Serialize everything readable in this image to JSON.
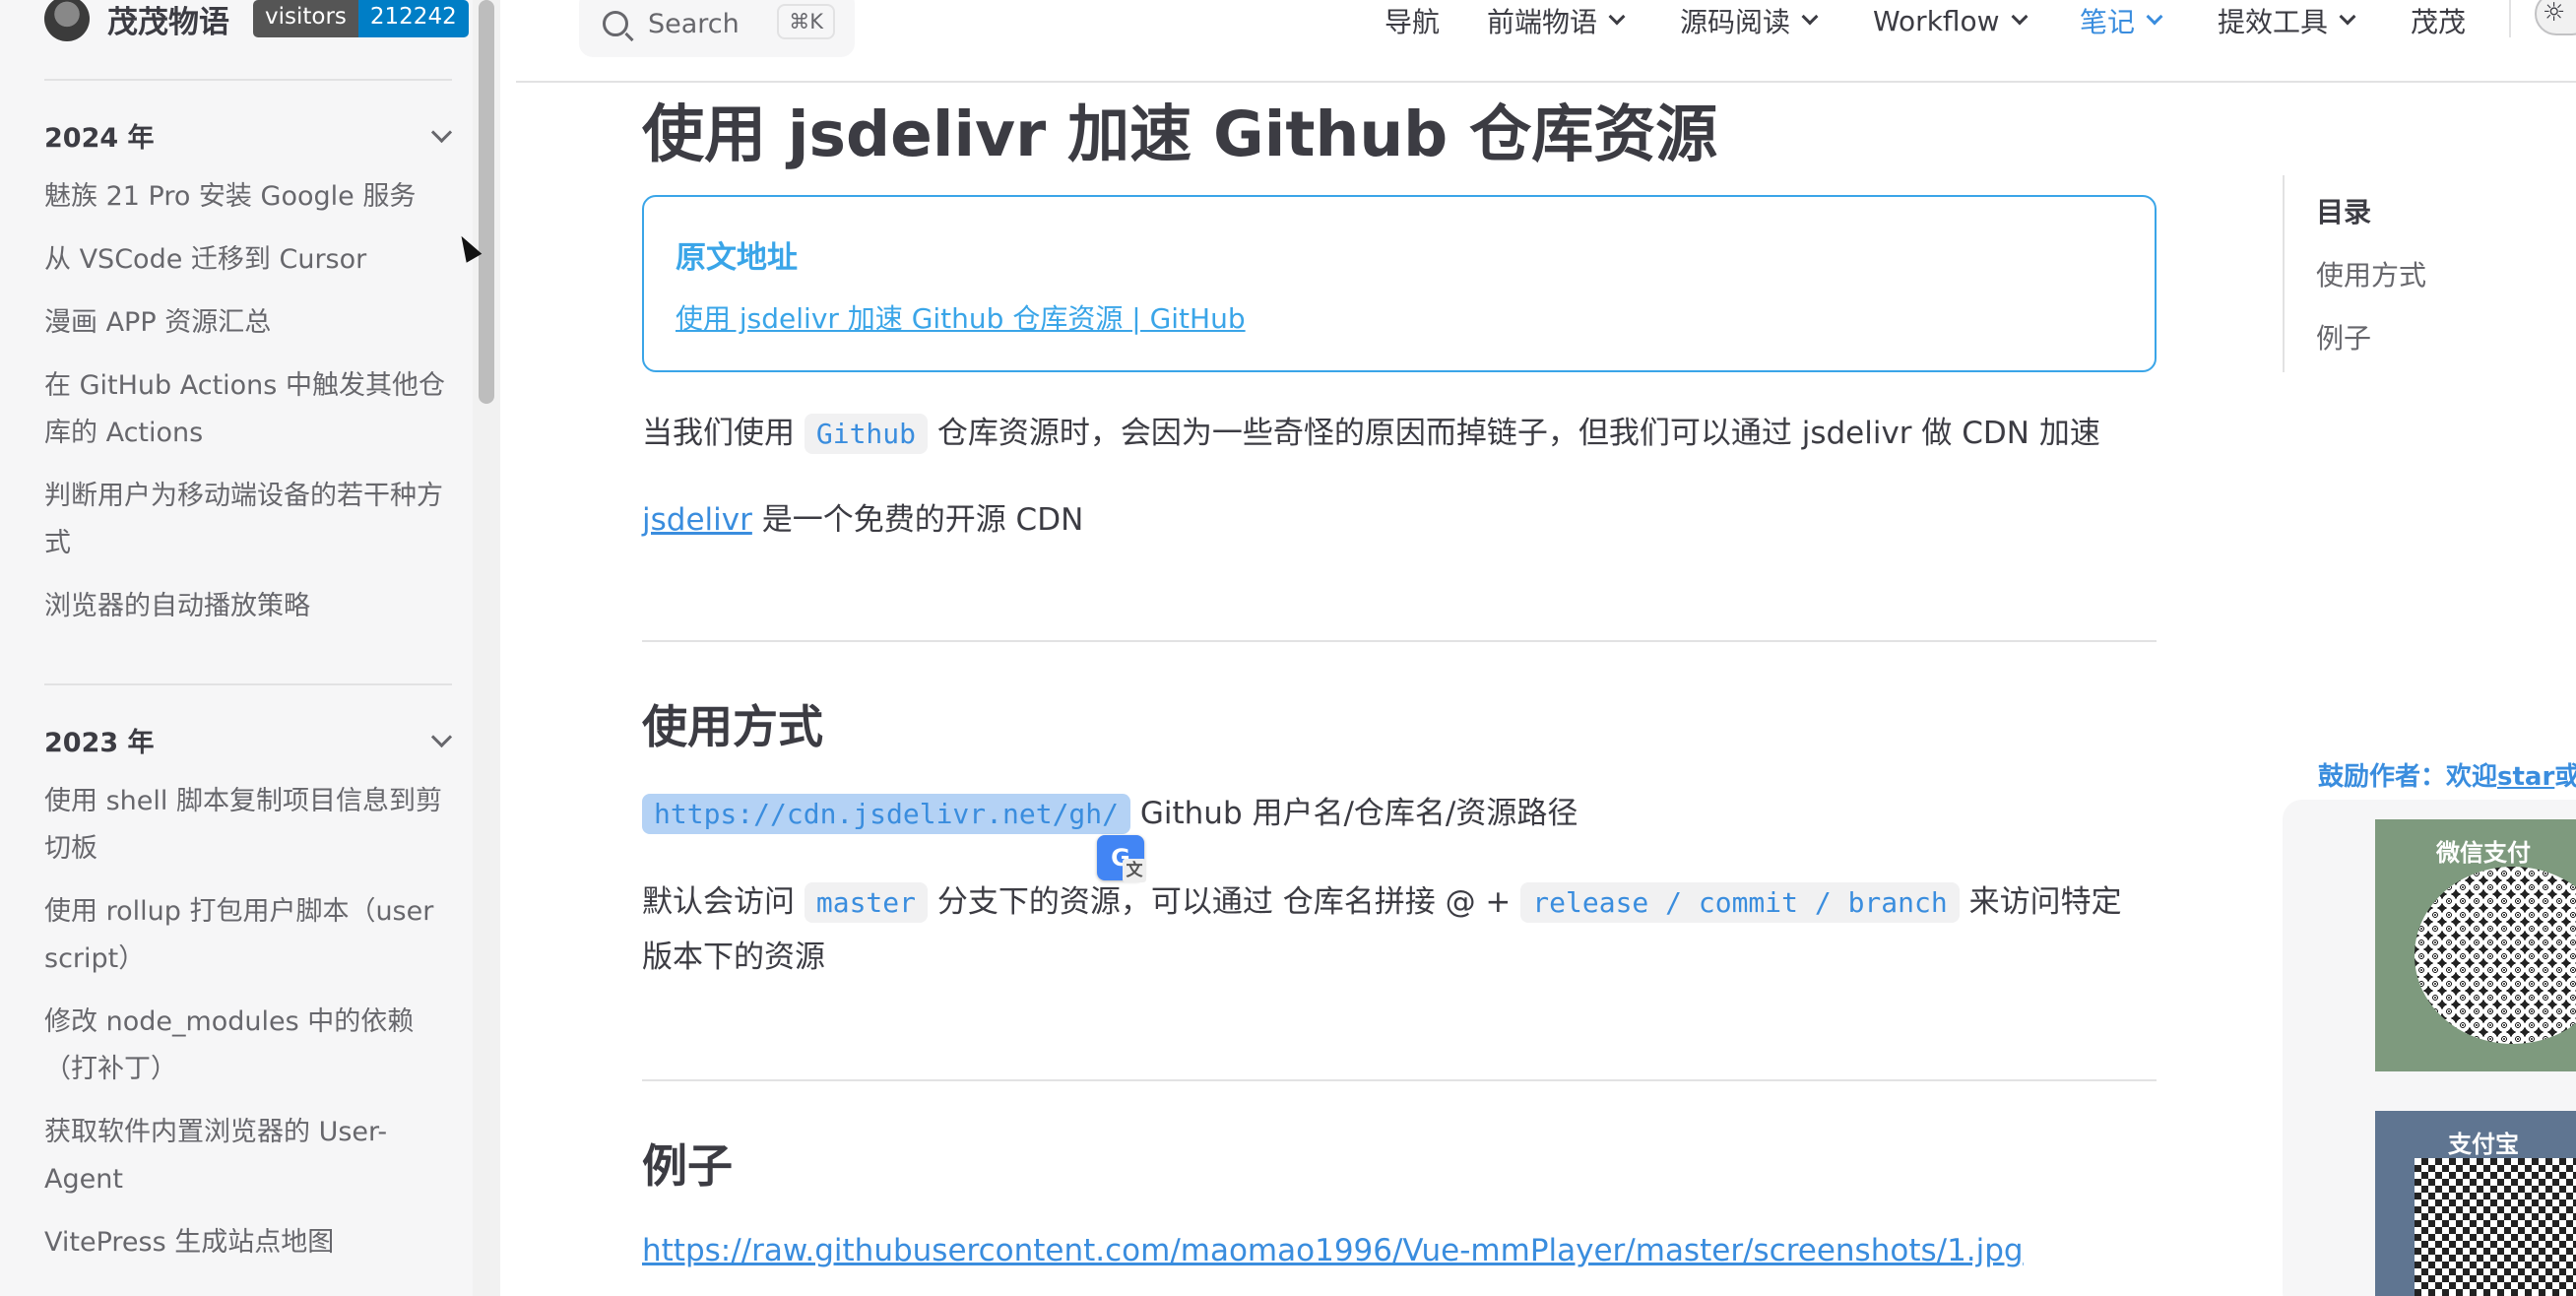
{
  "brand": {
    "name": "茂茂物语",
    "badge_label": "visitors",
    "badge_count": "212242"
  },
  "sidebar": {
    "groups": [
      {
        "title": "2024 年",
        "items": [
          "魅族 21 Pro 安装 Google 服务",
          "从 VSCode 迁移到 Cursor",
          "漫画 APP 资源汇总",
          "在 GitHub Actions 中触发其他仓库的 Actions",
          "判断用户为移动端设备的若干种方式",
          "浏览器的自动播放策略"
        ]
      },
      {
        "title": "2023 年",
        "items": [
          "使用 shell 脚本复制项目信息到剪切板",
          "使用 rollup 打包用户脚本（user script）",
          "修改 node_modules 中的依赖（打补丁）",
          "获取软件内置浏览器的 User-Agent",
          "VitePress 生成站点地图"
        ]
      }
    ]
  },
  "header": {
    "search_label": "Search",
    "search_shortcut": "⌘K",
    "nav": [
      {
        "label": "导航",
        "dropdown": false,
        "active": false
      },
      {
        "label": "前端物语",
        "dropdown": true,
        "active": false
      },
      {
        "label": "源码阅读",
        "dropdown": true,
        "active": false
      },
      {
        "label": "Workflow",
        "dropdown": true,
        "active": false
      },
      {
        "label": "笔记",
        "dropdown": true,
        "active": true
      },
      {
        "label": "提效工具",
        "dropdown": true,
        "active": false
      },
      {
        "label": "茂茂",
        "dropdown": false,
        "active": false
      }
    ]
  },
  "article": {
    "title": "使用 jsdelivr 加速 Github 仓库资源",
    "callout": {
      "title": "原文地址",
      "link": "使用 jsdelivr 加速 Github 仓库资源 | GitHub"
    },
    "p1": {
      "before": "当我们使用",
      "code": "Github",
      "after": "仓库资源时，会因为一些奇怪的原因而掉链子，但我们可以通过 jsdelivr 做 CDN 加速"
    },
    "p2": {
      "link": "jsdelivr",
      "after": "是一个免费的开源 CDN"
    },
    "h2_usage": "使用方式",
    "p3": {
      "code": "https://cdn.jsdelivr.net/gh/",
      "after": "Github 用户名/仓库名/资源路径"
    },
    "p4": {
      "before": "默认会访问",
      "code1": "master",
      "middle": "分支下的资源，可以通过 仓库名拼接 @ +",
      "code2": "release / commit / branch",
      "after": "来访问特定",
      "line2": "版本下的资源"
    },
    "h2_example": "例子",
    "example_link": "https://raw.githubusercontent.com/maomao1996/Vue-mmPlayer/master/screenshots/1.jpg"
  },
  "outline": {
    "title": "目录",
    "items": [
      "使用方式",
      "例子"
    ]
  },
  "sponsor": {
    "text_before": "鼓励作者：欢迎",
    "text_star": "star",
    "text_after": "或",
    "wechat_label": "微信支付",
    "alipay_label": "支付宝",
    "wechat_color": "#7e9a7e",
    "alipay_color": "#5f7591"
  },
  "colors": {
    "accent": "#3a8dde",
    "callout": "#3aa5e8",
    "badge_blue": "#007ec6"
  }
}
